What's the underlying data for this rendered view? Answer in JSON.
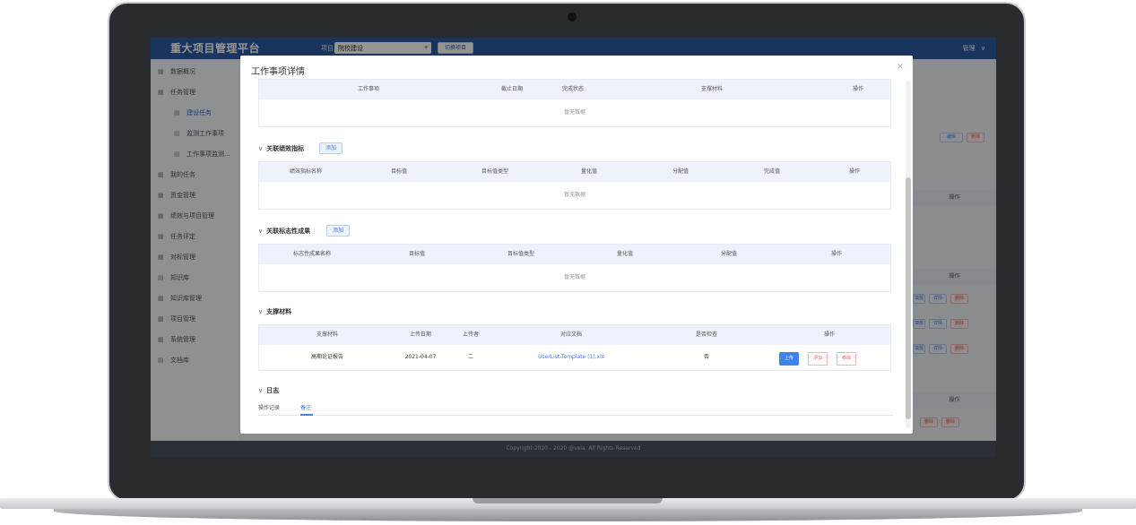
{
  "app": {
    "title": "重大项目管理平台",
    "project_label": "项目",
    "project_value": "院校建设",
    "switch_label": "切换项目",
    "user": "管理",
    "user_chevron": "∨"
  },
  "sidebar": {
    "items": [
      {
        "label": "数据概况",
        "icon": "grid-icon"
      },
      {
        "label": "任务管理",
        "icon": "grid-icon"
      },
      {
        "label": "建设任务",
        "icon": "doc-icon"
      },
      {
        "label": "监测工作事项",
        "icon": "doc-icon"
      },
      {
        "label": "工作事项监测...",
        "icon": "doc-icon"
      },
      {
        "label": "我的任务",
        "icon": "grid-icon"
      },
      {
        "label": "资金管理",
        "icon": "grid-icon"
      },
      {
        "label": "绩效与项目管理",
        "icon": "grid-icon"
      },
      {
        "label": "任务评定",
        "icon": "grid-icon"
      },
      {
        "label": "对标管理",
        "icon": "grid-icon"
      },
      {
        "label": "知识库",
        "icon": "doc-icon"
      },
      {
        "label": "知识库管理",
        "icon": "grid-icon"
      },
      {
        "label": "项目管理",
        "icon": "grid-icon"
      },
      {
        "label": "系统管理",
        "icon": "grid-icon"
      },
      {
        "label": "文档库",
        "icon": "doc-icon"
      }
    ]
  },
  "background": {
    "btn_edit": "编辑",
    "btn_delete": "删除",
    "col_action": "操作",
    "btn_fill": "填报",
    "btn_detail": "详情",
    "btn_del": "删除"
  },
  "footer": "Copyright 2020 - 2020 @vxia. All Rights Reserved",
  "modal": {
    "title": "工作事项详情",
    "close": "×",
    "work_table": {
      "headers": [
        "工作事项",
        "截止日期",
        "完成状态",
        "支撑材料",
        "操作"
      ],
      "empty": "暂无数据"
    },
    "kpi": {
      "title": "关联绩效指标",
      "chevron": "∨",
      "add": "添加",
      "headers": [
        "绩效指标名称",
        "目标值",
        "目标值类型",
        "量化值",
        "分配值",
        "完成值",
        "操作"
      ],
      "empty": "暂无数据"
    },
    "milestone": {
      "title": "关联标志性成果",
      "chevron": "∨",
      "add": "添加",
      "headers": [
        "标志性成果名称",
        "目标值",
        "目标值类型",
        "量化值",
        "分配值",
        "操作"
      ],
      "empty": "暂无数据"
    },
    "materials": {
      "title": "支撑材料",
      "chevron": "∨",
      "headers": [
        "支撑材料",
        "上传日期",
        "上传者",
        "对应文档",
        "是否检查",
        "操作"
      ],
      "rows": [
        {
          "name": "高期论证报告",
          "date": "2021-04-07",
          "uploader": "二",
          "doc": "UserList-Template (1).xls",
          "checked": "否"
        }
      ],
      "btn_upload": "上传",
      "btn_download": "添加",
      "btn_remove": "移除"
    },
    "log": {
      "title": "日志",
      "chevron": "∨",
      "tabs": [
        "操作记录",
        "备注"
      ]
    }
  }
}
